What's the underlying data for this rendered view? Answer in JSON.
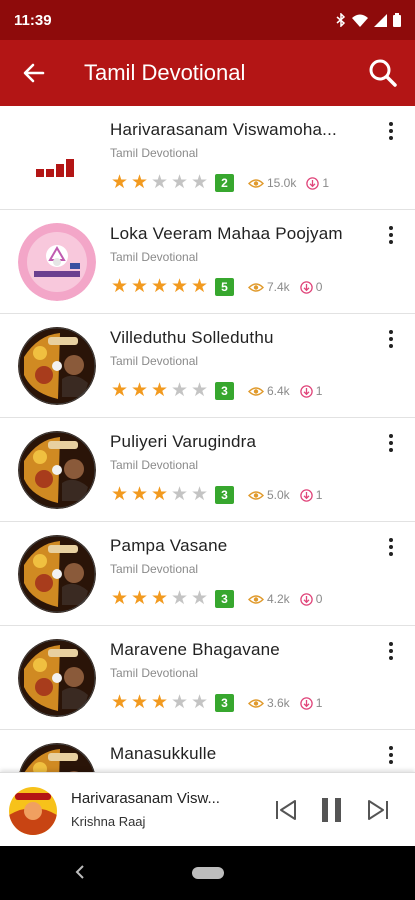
{
  "status_bar": {
    "time": "11:39",
    "icons": [
      "bluetooth-icon",
      "wifi-icon",
      "signal-icon",
      "battery-icon"
    ]
  },
  "app_bar": {
    "title": "Tamil Devotional",
    "back_icon": "arrow-left-icon",
    "search_icon": "search-icon"
  },
  "colors": {
    "status_bar": "#8e0b0b",
    "app_bar": "#b31515",
    "star_on": "#f29a1f",
    "star_off": "#c4c4c4",
    "badge": "#37a72e",
    "download_icon": "#e0457a"
  },
  "songs": [
    {
      "title": "Harivarasanam Viswamoha...",
      "category": "Tamil Devotional",
      "rating": 2,
      "views": "15.0k",
      "downloads": "1"
    },
    {
      "title": "Loka Veeram Mahaa Poojyam",
      "category": "Tamil Devotional",
      "rating": 5,
      "views": "7.4k",
      "downloads": "0"
    },
    {
      "title": "Villeduthu Solleduthu",
      "category": "Tamil Devotional",
      "rating": 3,
      "views": "6.4k",
      "downloads": "1"
    },
    {
      "title": "Puliyeri Varugindra",
      "category": "Tamil Devotional",
      "rating": 3,
      "views": "5.0k",
      "downloads": "1"
    },
    {
      "title": "Pampa Vasane",
      "category": "Tamil Devotional",
      "rating": 3,
      "views": "4.2k",
      "downloads": "0"
    },
    {
      "title": "Maravene Bhagavane",
      "category": "Tamil Devotional",
      "rating": 3,
      "views": "3.6k",
      "downloads": "1"
    },
    {
      "title": "Manasukkulle",
      "category": "",
      "rating": 0,
      "views": "",
      "downloads": ""
    }
  ],
  "player": {
    "title": "Harivarasanam Visw...",
    "artist": "Krishna Raaj",
    "prev_icon": "skip-previous-icon",
    "pause_icon": "pause-icon",
    "next_icon": "skip-next-icon"
  },
  "nav_bar": {
    "back_icon": "nav-back-icon",
    "home_icon": "home-pill-icon"
  }
}
